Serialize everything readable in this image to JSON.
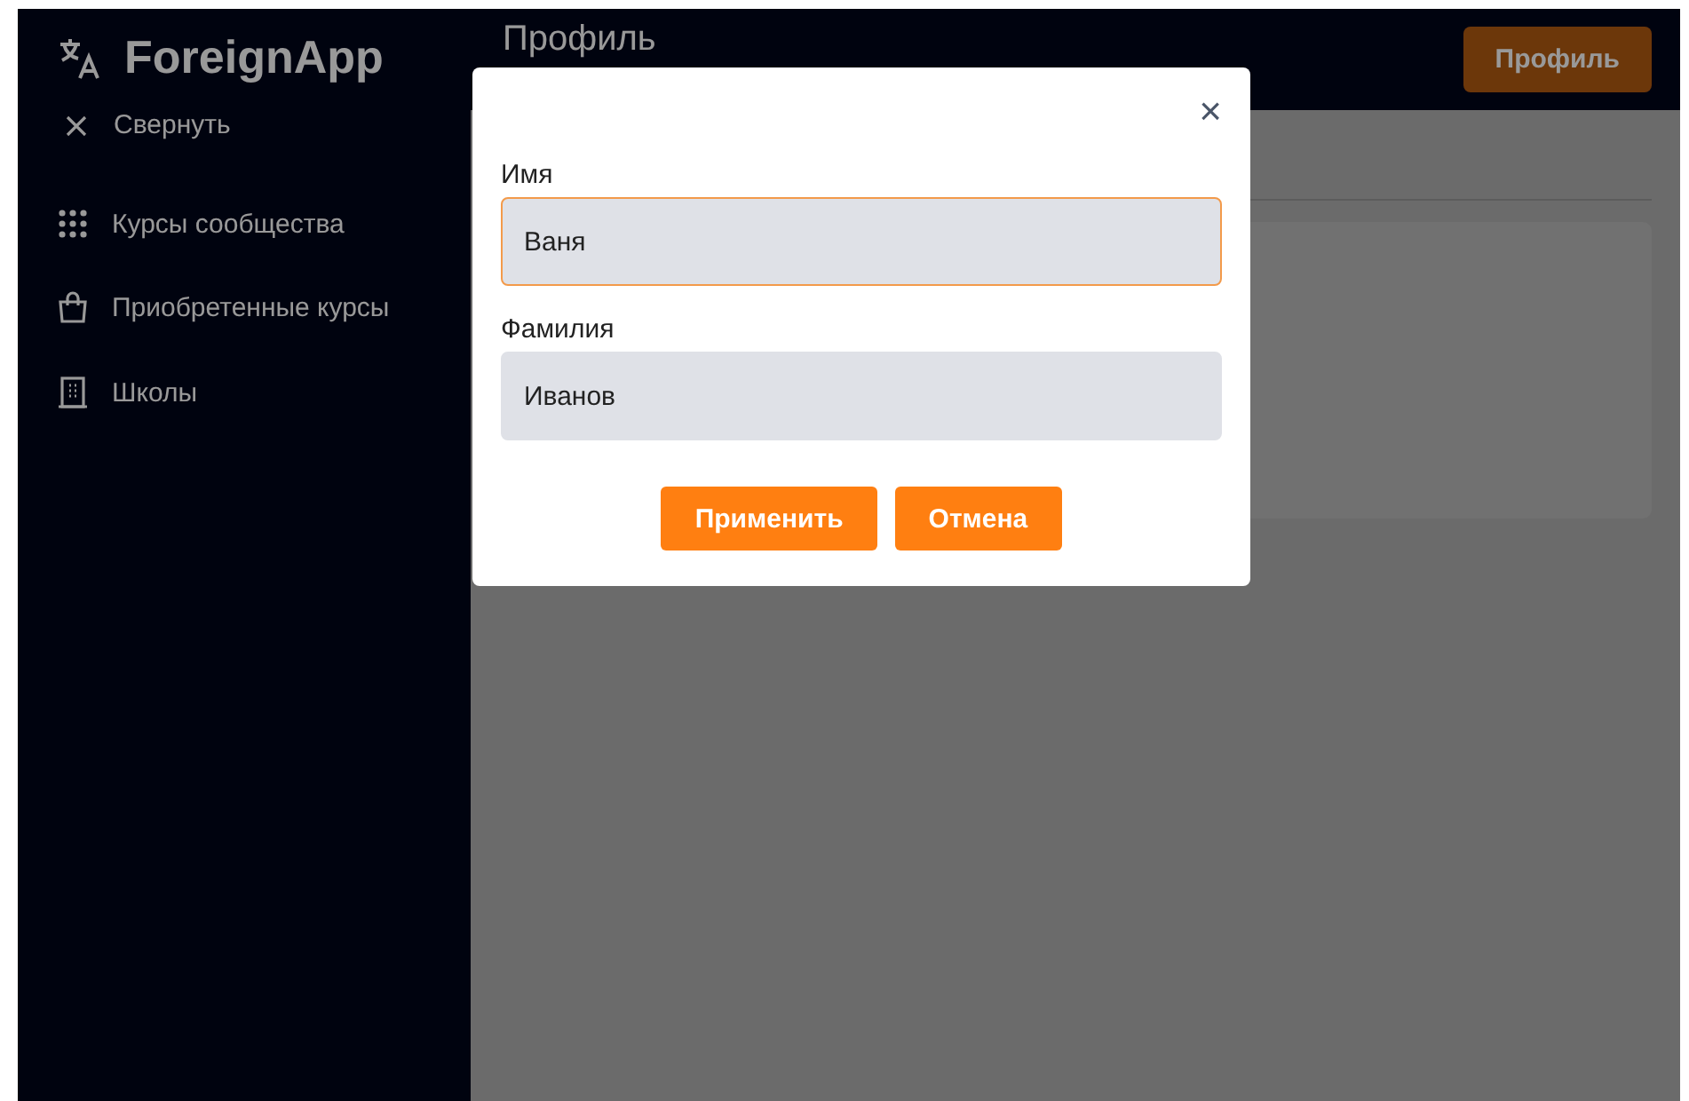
{
  "sidebar": {
    "logo": "ForeignApp",
    "collapse": "Свернуть",
    "items": [
      {
        "kind": "grid",
        "label": "Курсы сообщества"
      },
      {
        "kind": "bag",
        "label": "Приобретенные курсы"
      },
      {
        "kind": "building",
        "label": "Школы"
      }
    ]
  },
  "header": {
    "title": "Профиль",
    "button": "Профиль"
  },
  "dialog": {
    "close": "×",
    "fields": [
      {
        "label": "Имя",
        "value": "Ваня",
        "focused": true
      },
      {
        "label": "Фамилия",
        "value": "Иванов",
        "focused": false
      }
    ],
    "buttons": [
      "Применить",
      "Отмена"
    ]
  }
}
